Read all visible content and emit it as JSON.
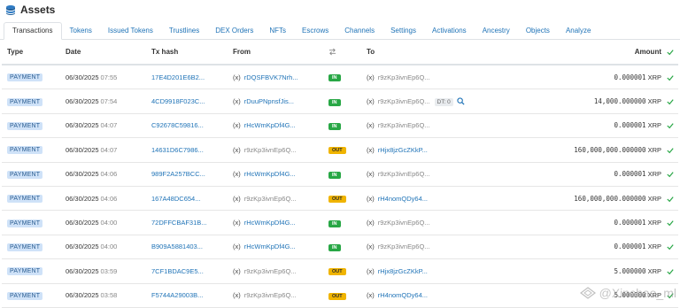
{
  "header": {
    "title": "Assets"
  },
  "tabs": [
    {
      "label": "Transactions",
      "active": true
    },
    {
      "label": "Tokens"
    },
    {
      "label": "Issued Tokens"
    },
    {
      "label": "Trustlines"
    },
    {
      "label": "DEX Orders"
    },
    {
      "label": "NFTs"
    },
    {
      "label": "Escrows"
    },
    {
      "label": "Channels"
    },
    {
      "label": "Settings"
    },
    {
      "label": "Activations"
    },
    {
      "label": "Ancestry"
    },
    {
      "label": "Objects"
    },
    {
      "label": "Analyze"
    }
  ],
  "table": {
    "headers": {
      "type": "Type",
      "date": "Date",
      "hash": "Tx hash",
      "from": "From",
      "to": "To",
      "amount": "Amount"
    },
    "rows": [
      {
        "type": "PAYMENT",
        "date": "06/30/2025",
        "time": "07:55",
        "hash": "17E4D201E6B2...",
        "from_prefix": "(x)",
        "from": "rDQSFBVK7Nrh...",
        "dir": "IN",
        "to_prefix": "(x)",
        "to": "r9zKp3ivnEp6Q...",
        "amount": "0.000001",
        "currency": "XRP"
      },
      {
        "type": "PAYMENT",
        "date": "06/30/2025",
        "time": "07:54",
        "hash": "4CD9918F023C...",
        "from_prefix": "(x)",
        "from": "rDuuPNpnsfJis...",
        "dir": "IN",
        "to_prefix": "(x)",
        "to": "r9zKp3ivnEp6Q...",
        "dt": "DT: 0",
        "amount": "14,000.000000",
        "currency": "XRP"
      },
      {
        "type": "PAYMENT",
        "date": "06/30/2025",
        "time": "04:07",
        "hash": "C92678C59816...",
        "from_prefix": "(x)",
        "from": "rHcWmKpDf4G...",
        "dir": "IN",
        "to_prefix": "(x)",
        "to": "r9zKp3ivnEp6Q...",
        "amount": "0.000001",
        "currency": "XRP"
      },
      {
        "type": "PAYMENT",
        "date": "06/30/2025",
        "time": "04:07",
        "hash": "14631D6C7986...",
        "from_prefix": "(x)",
        "from": "r9zKp3ivnEp6Q...",
        "dir": "OUT",
        "to_prefix": "(x)",
        "to": "rHjx8jzGcZKkP...",
        "amount": "160,000,000.000000",
        "currency": "XRP"
      },
      {
        "type": "PAYMENT",
        "date": "06/30/2025",
        "time": "04:06",
        "hash": "989F2A257BCC...",
        "from_prefix": "(x)",
        "from": "rHcWmKpDf4G...",
        "dir": "IN",
        "to_prefix": "(x)",
        "to": "r9zKp3ivnEp6Q...",
        "amount": "0.000001",
        "currency": "XRP"
      },
      {
        "type": "PAYMENT",
        "date": "06/30/2025",
        "time": "04:06",
        "hash": "167A48DC654...",
        "from_prefix": "(x)",
        "from": "r9zKp3ivnEp6Q...",
        "dir": "OUT",
        "to_prefix": "(x)",
        "to": "rH4nomQDy64...",
        "amount": "160,000,000.000000",
        "currency": "XRP"
      },
      {
        "type": "PAYMENT",
        "date": "06/30/2025",
        "time": "04:00",
        "hash": "72DFFCBAF31B...",
        "from_prefix": "(x)",
        "from": "rHcWmKpDf4G...",
        "dir": "IN",
        "to_prefix": "(x)",
        "to": "r9zKp3ivnEp6Q...",
        "amount": "0.000001",
        "currency": "XRP"
      },
      {
        "type": "PAYMENT",
        "date": "06/30/2025",
        "time": "04:00",
        "hash": "B909A5881403...",
        "from_prefix": "(x)",
        "from": "rHcWmKpDf4G...",
        "dir": "IN",
        "to_prefix": "(x)",
        "to": "r9zKp3ivnEp6Q...",
        "amount": "0.000001",
        "currency": "XRP"
      },
      {
        "type": "PAYMENT",
        "date": "06/30/2025",
        "time": "03:59",
        "hash": "7CF1BDAC9E5...",
        "from_prefix": "(x)",
        "from": "r9zKp3ivnEp6Q...",
        "dir": "OUT",
        "to_prefix": "(x)",
        "to": "rHjx8jzGcZKkP...",
        "amount": "5.000000",
        "currency": "XRP"
      },
      {
        "type": "PAYMENT",
        "date": "06/30/2025",
        "time": "03:58",
        "hash": "F5744A29003B...",
        "from_prefix": "(x)",
        "from": "r9zKp3ivnEp6Q...",
        "dir": "OUT",
        "to_prefix": "(x)",
        "to": "rH4nomQDy64...",
        "amount": "5.000000",
        "currency": "XRP"
      }
    ]
  },
  "watermark": {
    "text": "@Xinchao_ml"
  },
  "colors": {
    "link": "#1f73b7",
    "in_badge": "#28a745",
    "out_badge": "#f0b400",
    "type_badge": "#cfe2f8",
    "check": "#28a745"
  }
}
